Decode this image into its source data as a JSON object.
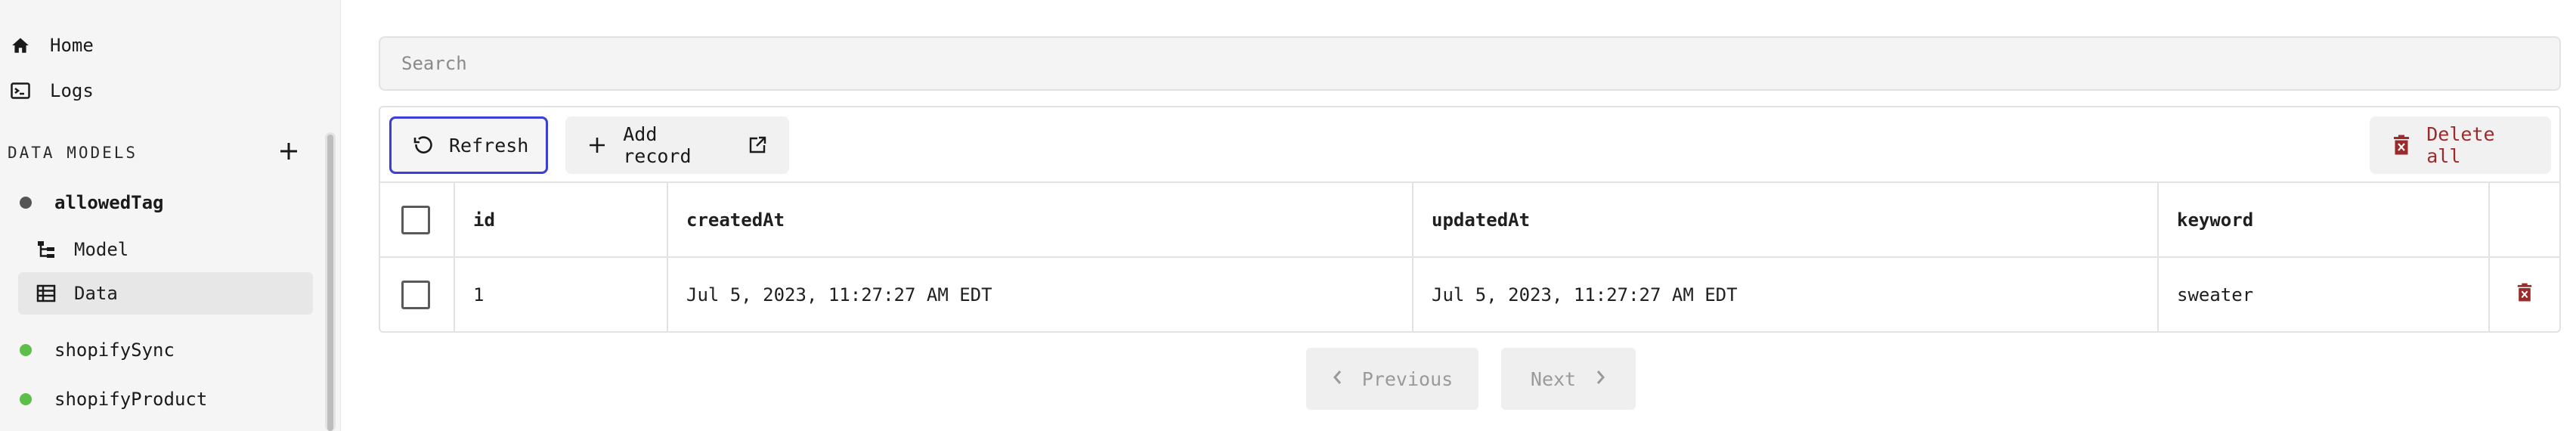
{
  "sidebar": {
    "nav": [
      {
        "label": "Home",
        "icon": "home-icon"
      },
      {
        "label": "Logs",
        "icon": "terminal-icon"
      }
    ],
    "section_label": "DATA MODELS",
    "models": [
      {
        "name": "allowedTag",
        "status_color": "#555555",
        "expanded": true,
        "children": [
          {
            "label": "Model",
            "icon": "schema-icon"
          },
          {
            "label": "Data",
            "icon": "table-icon",
            "active": true
          }
        ]
      },
      {
        "name": "shopifySync",
        "status_color": "#5cbf4a"
      },
      {
        "name": "shopifyProduct",
        "status_color": "#5cbf4a"
      }
    ]
  },
  "search": {
    "placeholder": "Search",
    "value": ""
  },
  "toolbar": {
    "refresh_label": "Refresh",
    "add_label": "Add record",
    "delete_all_label": "Delete all"
  },
  "table": {
    "columns": [
      "id",
      "createdAt",
      "updatedAt",
      "keyword"
    ],
    "rows": [
      {
        "id": "1",
        "createdAt": "Jul 5, 2023, 11:27:27 AM EDT",
        "updatedAt": "Jul 5, 2023, 11:27:27 AM EDT",
        "keyword": "sweater"
      }
    ]
  },
  "pagination": {
    "previous_label": "Previous",
    "next_label": "Next"
  },
  "colors": {
    "accent_focus": "#3b3fd8",
    "danger": "#9b2b2b",
    "status_ok": "#5cbf4a"
  }
}
